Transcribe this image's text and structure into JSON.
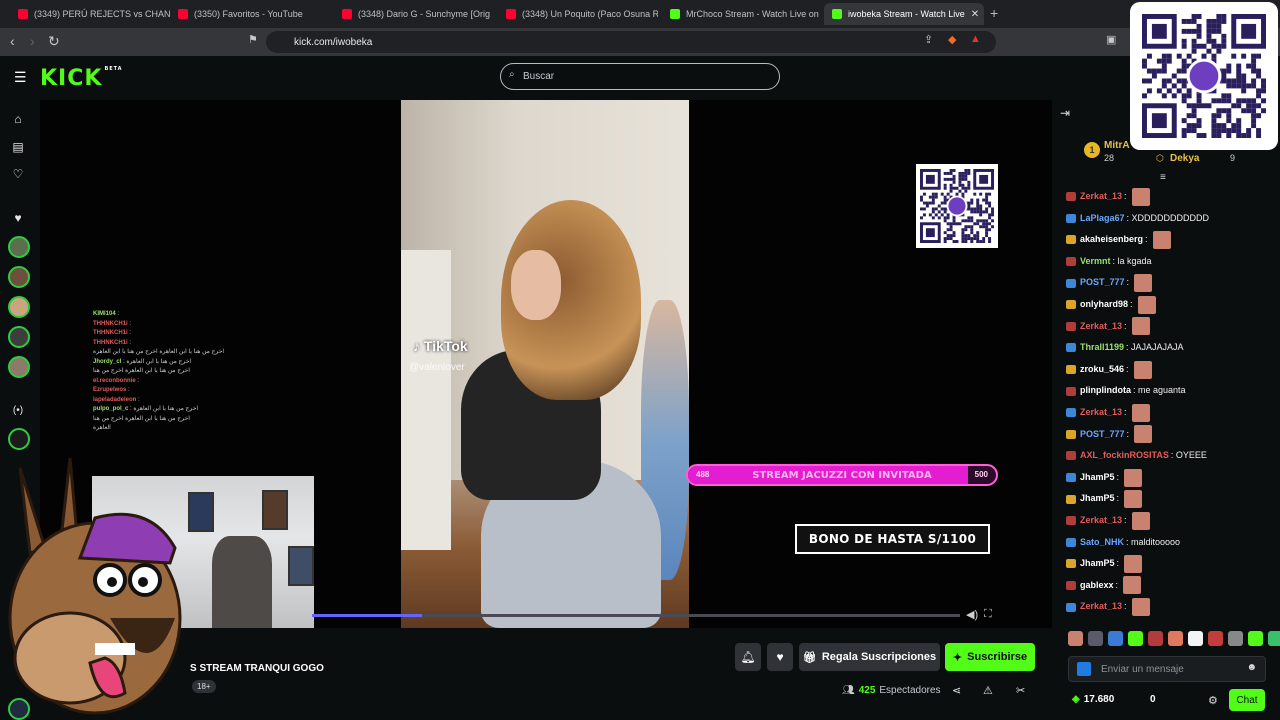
{
  "browser": {
    "tabs": [
      {
        "title": "(3349) PERÚ REJECTS vs CHANDOGS",
        "color": "#ff0033"
      },
      {
        "title": "(3350) Favoritos - YouTube",
        "color": "#ff0033"
      },
      {
        "title": "(3348) Dario G - Sunchyme [Orig",
        "color": "#ff0033"
      },
      {
        "title": "(3348) Un Poquito (Paco Osuna Rem",
        "color": "#ff0033"
      },
      {
        "title": "MrChoco Stream - Watch Live on",
        "color": "#53fc18"
      },
      {
        "title": "iwobeka Stream - Watch Live",
        "color": "#53fc18",
        "active": true
      }
    ],
    "url": "kick.com/iwobeka"
  },
  "header": {
    "logo": "KICK",
    "logo_tag": "BETA",
    "search_placeholder": "Buscar"
  },
  "player": {
    "tiktok_label": "TikTok",
    "tiktok_user": "@valenlover",
    "goal_text": "STREAM JACUZZI CON INVITADA",
    "goal_left": "488",
    "goal_right": "500",
    "goal_fraction": 0.91,
    "bono": "BONO DE HASTA S/1100",
    "progress_fraction": 0.17,
    "overlay_chat": [
      {
        "name": "KIMI104",
        "text": ":",
        "color": "#9be06b"
      },
      {
        "name": "THHNKCH1i",
        "text": ":",
        "color": "#e05c5c"
      },
      {
        "name": "THHNKCH1i",
        "text": ":",
        "color": "#e05c5c"
      },
      {
        "name": "THHNKCH1i",
        "text": ":",
        "color": "#e05c5c"
      },
      {
        "name": "",
        "text": "اخرج من هنا يا ابن العاهرة اخرج من هنا يا ابن العاهرة",
        "color": "#ccc"
      },
      {
        "name": "Jhordy_cl",
        "text": ": اخرج من هنا يا ابن العاهرة",
        "color": "#9be06b"
      },
      {
        "name": "",
        "text": "اخرج من هنا يا ابن العاهرة اخرج من هنا",
        "color": "#ccc"
      },
      {
        "name": "el.reconbonnie",
        "text": ":",
        "color": "#e05c5c"
      },
      {
        "name": "Ezrupelwos",
        "text": ":",
        "color": "#e05c5c"
      },
      {
        "name": "lapeladadeleon",
        "text": ":",
        "color": "#e05c5c"
      },
      {
        "name": "pulpo_pol_c",
        "text": ": اخرج من هنا يا ابن العاهرة",
        "color": "#9be06b"
      },
      {
        "name": "",
        "text": "اخرج من هنا يا ابن العاهرة اخرج من هنا",
        "color": "#ccc"
      },
      {
        "name": "",
        "text": "العاهرة",
        "color": "#ccc"
      }
    ]
  },
  "below": {
    "title": "S STREAM TRANQUI GOGO",
    "age": "18+",
    "gift_label": "Regala Suscripciones",
    "subscribe_label": "Suscribirse",
    "viewers_count": "425",
    "viewers_label": "Espectadores"
  },
  "chat": {
    "leader1_name": "MitrA",
    "leader1_count": "28",
    "leader2_name": "Dekya",
    "leader2_count": "9",
    "messages": [
      {
        "user": "Zerkat_13",
        "text": ":",
        "color": "#e35b5b",
        "emote": true
      },
      {
        "user": "LaPlaga67",
        "text": ": XDDDDDDDDDDD",
        "color": "#69a7ff",
        "emote": false
      },
      {
        "user": "akaheisenberg",
        "text": ":",
        "color": "#ffffff",
        "emote": true
      },
      {
        "user": "Vermnt",
        "text": ": la kgada",
        "color": "#9be06b",
        "emote": false
      },
      {
        "user": "POST_777",
        "text": ":",
        "color": "#69a7ff",
        "emote": true
      },
      {
        "user": "onlyhard98",
        "text": ":",
        "color": "#ffffff",
        "emote": true
      },
      {
        "user": "Zerkat_13",
        "text": ":",
        "color": "#e35b5b",
        "emote": true
      },
      {
        "user": "Thrall1199",
        "text": ": JAJAJAJAJA",
        "color": "#9be06b",
        "emote": false
      },
      {
        "user": "zroku_546",
        "text": ":",
        "color": "#ffffff",
        "emote": true
      },
      {
        "user": "plinplindota",
        "text": ": me aguanta",
        "color": "#ffffff",
        "emote": false
      },
      {
        "user": "Zerkat_13",
        "text": ":",
        "color": "#e35b5b",
        "emote": true
      },
      {
        "user": "POST_777",
        "text": ":",
        "color": "#69a7ff",
        "emote": true
      },
      {
        "user": "AXL_fockinROSITAS",
        "text": ": OYEEE",
        "color": "#e35b5b",
        "emote": false
      },
      {
        "user": "JhamP5",
        "text": ":",
        "color": "#ffffff",
        "emote": true
      },
      {
        "user": "JhamP5",
        "text": ":",
        "color": "#ffffff",
        "emote": true
      },
      {
        "user": "Zerkat_13",
        "text": ":",
        "color": "#e35b5b",
        "emote": true
      },
      {
        "user": "Sato_NHK",
        "text": ": malditooooo",
        "color": "#69a7ff",
        "emote": false
      },
      {
        "user": "JhamP5",
        "text": ":",
        "color": "#ffffff",
        "emote": true
      },
      {
        "user": "gablexx",
        "text": ":",
        "color": "#ffffff",
        "emote": true
      },
      {
        "user": "Zerkat_13",
        "text": ":",
        "color": "#e35b5b",
        "emote": true
      }
    ],
    "input_placeholder": "Enviar un mensaje",
    "points": "17.680",
    "zero": "0",
    "send_label": "Chat"
  }
}
